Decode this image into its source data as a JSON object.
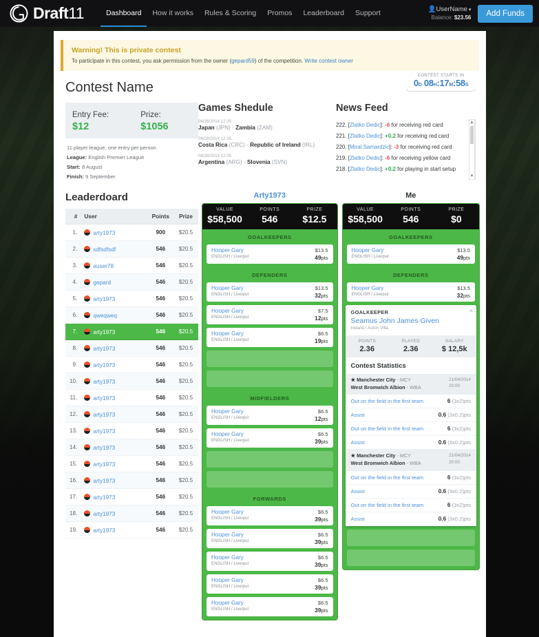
{
  "header": {
    "brand_main": "Draft",
    "brand_thin": "11",
    "nav": [
      {
        "label": "Dashboard",
        "active": true
      },
      {
        "label": "How it works",
        "active": false
      },
      {
        "label": "Rules & Scoring",
        "active": false
      },
      {
        "label": "Promos",
        "active": false
      },
      {
        "label": "Leaderboard",
        "active": false
      },
      {
        "label": "Support",
        "active": false
      }
    ],
    "username": "UserName",
    "balance_label": "Balance:",
    "balance_value": "$23.56",
    "add_funds": "Add Funds"
  },
  "warning": {
    "title": "Warning! This is private contest",
    "body_1": "To participate in this contest, you ask permission from the owner (",
    "owner": "gepard59",
    "body_2": ") of the competition. ",
    "write_link": "Write contest owner"
  },
  "contest": {
    "name": "Contest Name",
    "countdown_label": "CONTEST STARTS IN",
    "countdown": {
      "d": "0",
      "du": "D",
      "h": "08",
      "hu": "H",
      "m": "17",
      "mu": "M",
      "s": "58",
      "su": "S"
    },
    "entry_fee_label": "Entry Fee:",
    "entry_fee": "$12",
    "prize_label": "Prize:",
    "prize": "$1056",
    "description": "11 player league, one entry per person",
    "league_label": "League:",
    "league": "English Premier League",
    "start_label": "Start:",
    "start": "8 August",
    "finish_label": "Finish:",
    "finish": "9 September"
  },
  "games": {
    "title": "Games Shedule",
    "items": [
      {
        "date": "06/28/2014 12:35",
        "home": "Japan",
        "home_code": "(JPN)",
        "away": "Zambia",
        "away_code": "(ZAM)"
      },
      {
        "date": "06/28/2014 12:35",
        "home": "Costa Rica",
        "home_code": "(CRC)",
        "away": "Republic of Ireland",
        "away_code": "(IRL)"
      },
      {
        "date": "06/28/2014 12:35",
        "home": "Argentina",
        "home_code": "(ARG)",
        "away": "Slovenia",
        "away_code": "(SVN)"
      }
    ]
  },
  "news": {
    "title": "News Feed",
    "items": [
      {
        "num": "222.",
        "player": "Zlatko Dedic",
        "delta": "-6",
        "sign": "neg",
        "text": "for receiving red card"
      },
      {
        "num": "221.",
        "player": "Zlatko Dedic",
        "delta": "+0.2",
        "sign": "pos",
        "text": "for receiving red card"
      },
      {
        "num": "220.",
        "player": "Miral Samardzic",
        "delta": "-3",
        "sign": "neg",
        "text": "for receiving red card"
      },
      {
        "num": "219.",
        "player": "Zlatko Dedic",
        "delta": "-6",
        "sign": "neg",
        "text": "for receiving yellow card"
      },
      {
        "num": "218.",
        "player": "Zlatko Dedic",
        "delta": "+0.2",
        "sign": "pos",
        "text": "for playing in start setup"
      }
    ]
  },
  "leaderboard": {
    "title": "Leaderdoard",
    "columns": [
      "#",
      "User",
      "Points",
      "Prize"
    ],
    "rows": [
      {
        "rank": "1.",
        "user": "arty1973",
        "points": "900",
        "prize": "$20.5",
        "me": false
      },
      {
        "rank": "2.",
        "user": "sdfsdfsdf",
        "points": "546",
        "prize": "$20.5",
        "me": false
      },
      {
        "rank": "3.",
        "user": "auser78",
        "points": "546",
        "prize": "$20.5",
        "me": false
      },
      {
        "rank": "4.",
        "user": "gepard",
        "points": "546",
        "prize": "$20.5",
        "me": false
      },
      {
        "rank": "5.",
        "user": "arty1973",
        "points": "546",
        "prize": "$20.5",
        "me": false
      },
      {
        "rank": "6.",
        "user": "qweqweq",
        "points": "546",
        "prize": "$20.5",
        "me": false
      },
      {
        "rank": "7.",
        "user": "arty1973",
        "points": "546",
        "prize": "$20.5",
        "me": true
      },
      {
        "rank": "8.",
        "user": "arty1973",
        "points": "546",
        "prize": "$20.5",
        "me": false
      },
      {
        "rank": "9.",
        "user": "arty1973",
        "points": "546",
        "prize": "$20.5",
        "me": false
      },
      {
        "rank": "10.",
        "user": "arty1973",
        "points": "546",
        "prize": "$20.5",
        "me": false
      },
      {
        "rank": "11.",
        "user": "arty1973",
        "points": "546",
        "prize": "$20.5",
        "me": false
      },
      {
        "rank": "12.",
        "user": "arty1973",
        "points": "546",
        "prize": "$20.5",
        "me": false
      },
      {
        "rank": "13.",
        "user": "arty1973",
        "points": "546",
        "prize": "$20.5",
        "me": false
      },
      {
        "rank": "14.",
        "user": "arty1973",
        "points": "546",
        "prize": "$20.5",
        "me": false
      },
      {
        "rank": "15.",
        "user": "arty1973",
        "points": "546",
        "prize": "$20.5",
        "me": false
      },
      {
        "rank": "16.",
        "user": "arty1973",
        "points": "546",
        "prize": "$20.5",
        "me": false
      },
      {
        "rank": "17.",
        "user": "arty1973",
        "points": "546",
        "prize": "$20.5",
        "me": false
      },
      {
        "rank": "18.",
        "user": "arty1973",
        "points": "546",
        "prize": "$20.5",
        "me": false
      },
      {
        "rank": "19.",
        "user": "arty1973",
        "points": "546",
        "prize": "$20.5",
        "me": false
      }
    ]
  },
  "team_left": {
    "name": "Arty1973",
    "summary": [
      {
        "key": "VALUE",
        "value": "$58,500"
      },
      {
        "key": "POINTS",
        "value": "546"
      },
      {
        "key": "PRIZE",
        "value": "$12.5"
      }
    ],
    "groups": [
      {
        "label": "GOALKEEPERS",
        "slots": [
          {
            "empty": false,
            "name": "Hooper Gary",
            "team": "ENGLISH / Liverpul",
            "salary": "$13.5",
            "points": "49",
            "points_unit": "pts"
          }
        ]
      },
      {
        "label": "DEFENDERS",
        "slots": [
          {
            "empty": false,
            "name": "Hooper Gary",
            "team": "ENGLISH / Liverpul",
            "salary": "$13.5",
            "points": "32",
            "points_unit": "pts"
          },
          {
            "empty": false,
            "name": "Hooper Gary",
            "team": "ENGLISH / Liverpul",
            "salary": "$7.5",
            "points": "12",
            "points_unit": "pts"
          },
          {
            "empty": false,
            "name": "Hooper Gary",
            "team": "ENGLISH / Liverpul",
            "salary": "$6.5",
            "points": "19",
            "points_unit": "pts"
          },
          {
            "empty": true
          },
          {
            "empty": true
          }
        ]
      },
      {
        "label": "MIDFIELDERS",
        "slots": [
          {
            "empty": false,
            "name": "Hooper Gary",
            "team": "ENGLISH / Liverpul",
            "salary": "$6.5",
            "points": "12",
            "points_unit": "pts"
          },
          {
            "empty": false,
            "name": "Hooper Gary",
            "team": "ENGLISH / Liverpul",
            "salary": "$6.5",
            "points": "39",
            "points_unit": "pts"
          },
          {
            "empty": true
          },
          {
            "empty": true
          }
        ]
      },
      {
        "label": "FORWARDS",
        "slots": [
          {
            "empty": false,
            "name": "Hooper Gary",
            "team": "ENGLISH / Liverpul",
            "salary": "$6.5",
            "points": "39",
            "points_unit": "pts"
          },
          {
            "empty": false,
            "name": "Hooper Gary",
            "team": "ENGLISH / Liverpul",
            "salary": "$6.5",
            "points": "39",
            "points_unit": "pts"
          },
          {
            "empty": false,
            "name": "Hooper Gary",
            "team": "ENGLISH / Liverpul",
            "salary": "$6.5",
            "points": "39",
            "points_unit": "pts"
          },
          {
            "empty": false,
            "name": "Hooper Gary",
            "team": "ENGLISH / Liverpul",
            "salary": "$6.5",
            "points": "39",
            "points_unit": "pts"
          },
          {
            "empty": false,
            "name": "Hooper Gary",
            "team": "ENGLISH / Liverpul",
            "salary": "$6.5",
            "points": "39",
            "points_unit": "pts"
          }
        ]
      }
    ]
  },
  "team_right": {
    "name": "Me",
    "summary": [
      {
        "key": "VALUE",
        "value": "$58,500"
      },
      {
        "key": "POINTS",
        "value": "546"
      },
      {
        "key": "PRIZE",
        "value": "$0"
      }
    ],
    "groups": [
      {
        "label": "GOALKEEPERS",
        "slots": [
          {
            "empty": false,
            "name": "Hooper Gary",
            "team": "ENGLISH / Liverpul",
            "salary": "$13.5",
            "points": "49",
            "points_unit": "pts"
          }
        ]
      },
      {
        "label": "DEFENDERS",
        "slots": [
          {
            "empty": false,
            "name": "Hooper Gary",
            "team": "ENGLISH / Liverpul",
            "salary": "$13.5",
            "points": "32",
            "points_unit": "pts"
          }
        ]
      }
    ],
    "trailing_empty_slots": 2
  },
  "popup": {
    "close": "×",
    "position": "GOALKEEPER",
    "player_name": "Seamus John James Given",
    "player_team": "Ireland / Aston Villa",
    "stats": [
      {
        "key": "POINTS",
        "value": "2.36"
      },
      {
        "key": "PLAYED",
        "value": "2.36"
      },
      {
        "key": "SALARY",
        "value": "$ 12,5k"
      }
    ],
    "section_title": "Contest Statistics",
    "matches": [
      {
        "home": "Manchester City",
        "home_code": "- MCY",
        "away": "West Bromwich Albion",
        "away_code": "- WBA",
        "date": "21/04/2014",
        "time": "20:00",
        "events": [
          {
            "label": "Out on the field in the first team",
            "value": "6",
            "formula": "(3x2)pts"
          },
          {
            "label": "Assist",
            "value": "0.6",
            "formula": "(3x0.2)pts"
          },
          {
            "label": "Out on the field in the first team",
            "value": "6",
            "formula": "(3x2)pts"
          },
          {
            "label": "Assist",
            "value": "0.6",
            "formula": "(3x0.2)pts"
          }
        ]
      },
      {
        "home": "Manchester City",
        "home_code": "- MCY",
        "away": "West Bromwich Albion",
        "away_code": "- WBA",
        "date": "21/04/2014",
        "time": "20:00",
        "events": [
          {
            "label": "Out on the field in the first team",
            "value": "6",
            "formula": "(3x2)pts"
          },
          {
            "label": "Assist",
            "value": "0.6",
            "formula": "(3x0.2)pts"
          },
          {
            "label": "Out on the field in the first team",
            "value": "6",
            "formula": "(3x2)pts"
          },
          {
            "label": "Assist",
            "value": "0.6",
            "formula": "(3x0.2)pts"
          }
        ]
      }
    ]
  },
  "colors": {
    "brand_blue": "#3a9ad9",
    "green": "#4cb847",
    "link": "#4a90d9",
    "warning_bg": "#fcf8e3",
    "warning_border": "#e0a82e",
    "money_green": "#33b14c",
    "negative": "#e04b4b",
    "positive": "#2fa84f"
  }
}
